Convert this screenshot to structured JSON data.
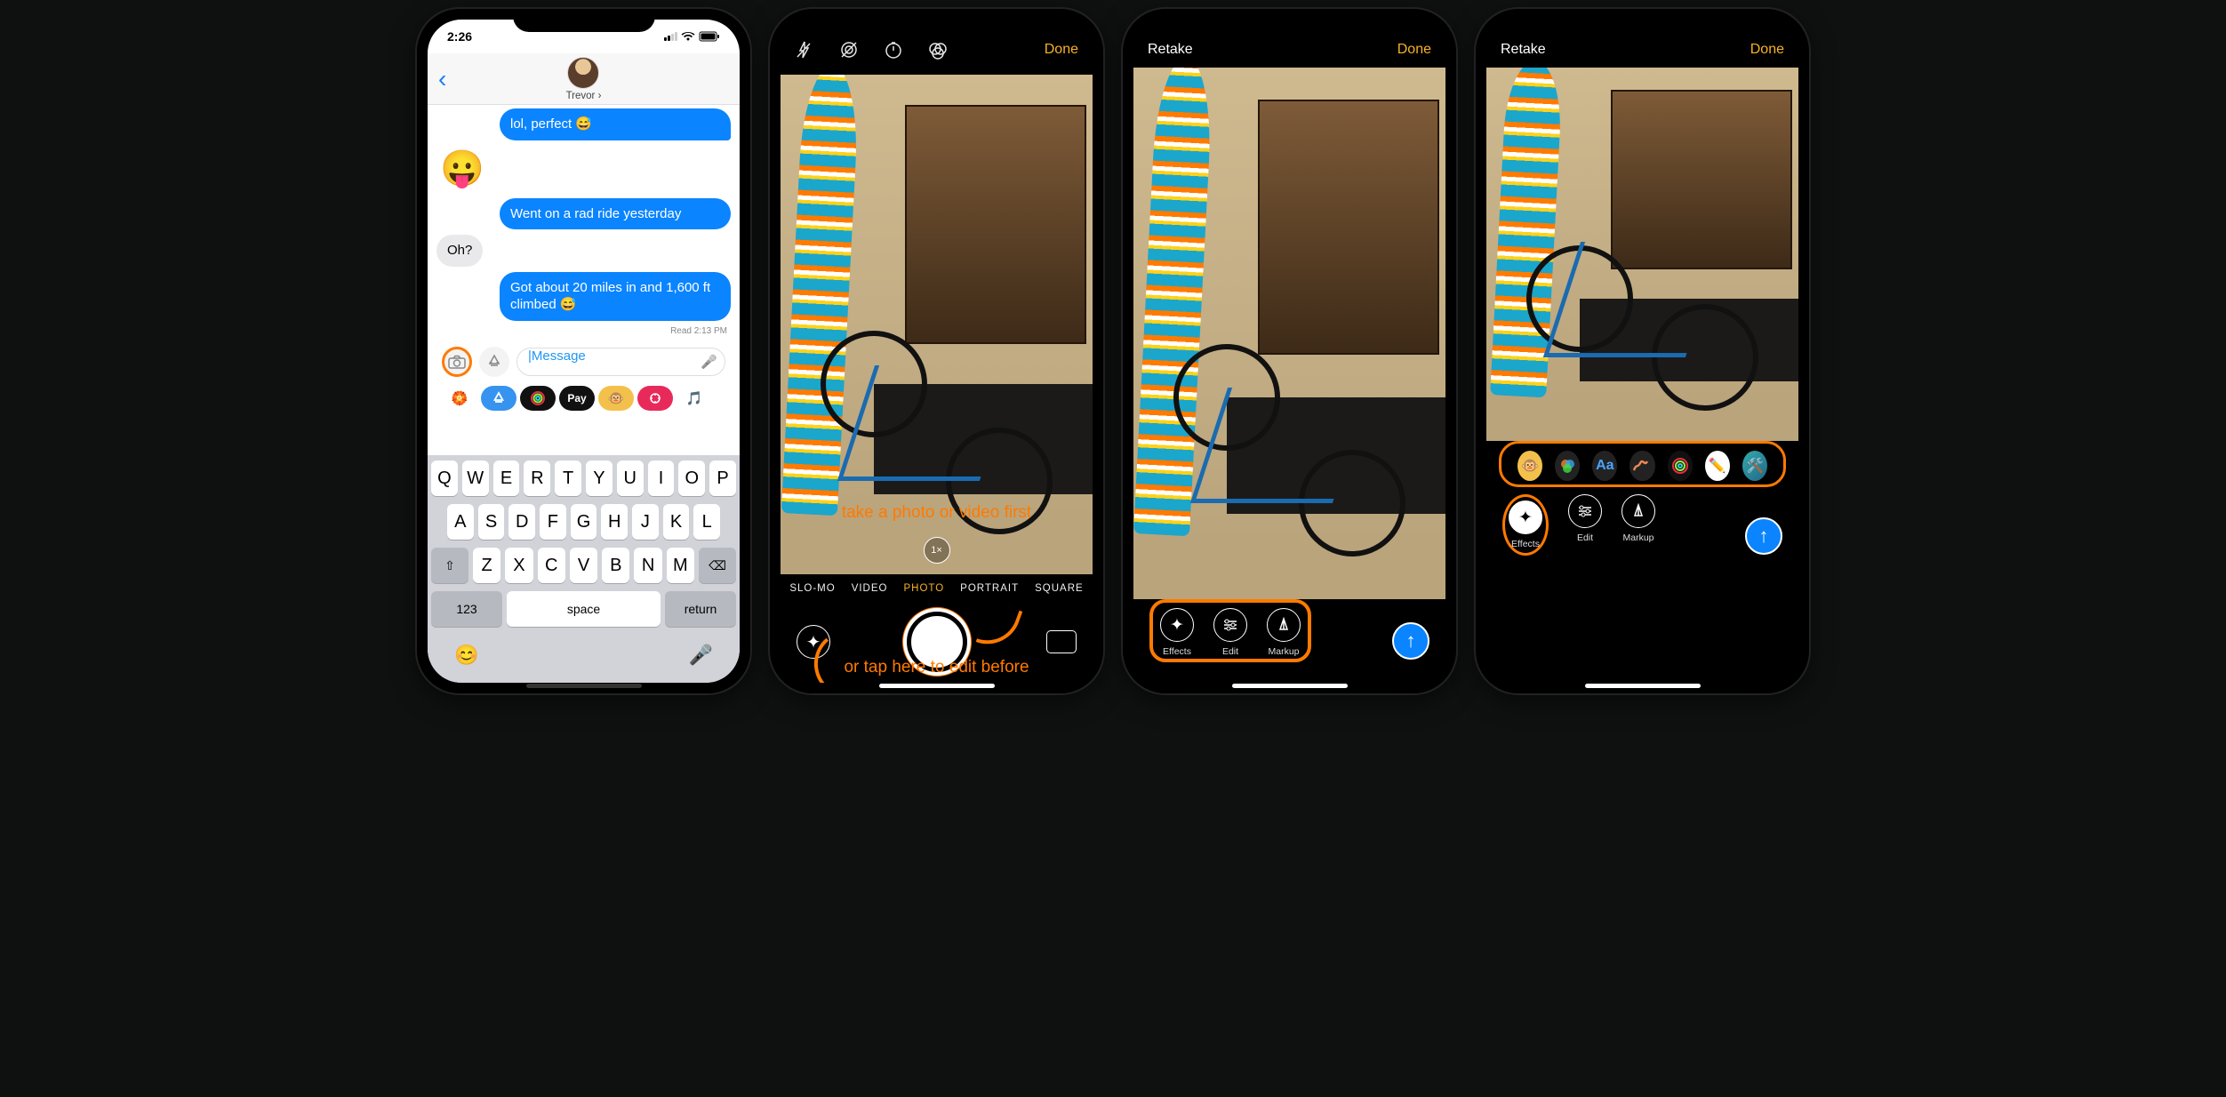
{
  "phone1": {
    "time": "2:26",
    "contact_name": "Trevor ›",
    "messages": {
      "m1": "lol, perfect 😅",
      "emoji": "😛",
      "m2": "Went on a rad ride yesterday",
      "m3": "Oh?",
      "m4": "Got about 20 miles in and 1,600 ft climbed 😅",
      "read": "Read 2:13 PM"
    },
    "input_placeholder": "iMessage",
    "keyboard": {
      "r1": [
        "Q",
        "W",
        "E",
        "R",
        "T",
        "Y",
        "U",
        "I",
        "O",
        "P"
      ],
      "r2": [
        "A",
        "S",
        "D",
        "F",
        "G",
        "H",
        "J",
        "K",
        "L"
      ],
      "r3": [
        "Z",
        "X",
        "C",
        "V",
        "B",
        "N",
        "M"
      ],
      "nums": "123",
      "space": "space",
      "return": "return"
    }
  },
  "phone2": {
    "done": "Done",
    "zoom": "1×",
    "modes": {
      "slomo": "SLO-MO",
      "video": "VIDEO",
      "photo": "PHOTO",
      "portrait": "PORTRAIT",
      "square": "SQUARE"
    },
    "ann1": "take a photo or video first",
    "ann2": "or tap here to edit before"
  },
  "phone3": {
    "retake": "Retake",
    "done": "Done",
    "effects": "Effects",
    "edit": "Edit",
    "markup": "Markup"
  },
  "phone4": {
    "retake": "Retake",
    "done": "Done",
    "effects": "Effects",
    "edit": "Edit",
    "markup": "Markup",
    "fx": {
      "aa": "Aa"
    }
  }
}
